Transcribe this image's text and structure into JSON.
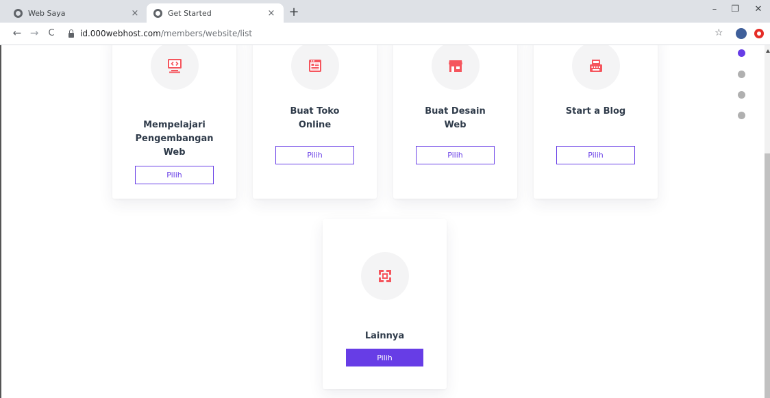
{
  "tabs": [
    {
      "title": "Web Saya",
      "icon": "globe-icon"
    },
    {
      "title": "Get Started",
      "icon": "globe-icon"
    }
  ],
  "new_tab": "+",
  "window_controls": {
    "minimize": "–",
    "restore": "❐",
    "close": "✕"
  },
  "nav": {
    "back": "←",
    "forward": "→",
    "reload": "C"
  },
  "url": {
    "host": "id.000webhost.com",
    "path": "/members/website/list"
  },
  "accent_color": "#673de6",
  "icon_color": "#f5555d",
  "cards": [
    {
      "title_lines": [
        "Mempelajari",
        "Pengembangan",
        "Web"
      ],
      "button": "Pilih",
      "icon": "monitor-code-icon"
    },
    {
      "title_lines": [
        "Buat Toko",
        "Online"
      ],
      "button": "Pilih",
      "icon": "store-list-icon"
    },
    {
      "title_lines": [
        "Buat Desain",
        "Web"
      ],
      "button": "Pilih",
      "icon": "shop-awning-icon"
    },
    {
      "title_lines": [
        "Start a Blog"
      ],
      "button": "Pilih",
      "icon": "typewriter-icon"
    },
    {
      "title_lines": [
        "Lainnya"
      ],
      "button": "Pilih",
      "icon": "expand-icon"
    }
  ],
  "progress_dots": {
    "count": 4,
    "active_index": 0
  }
}
